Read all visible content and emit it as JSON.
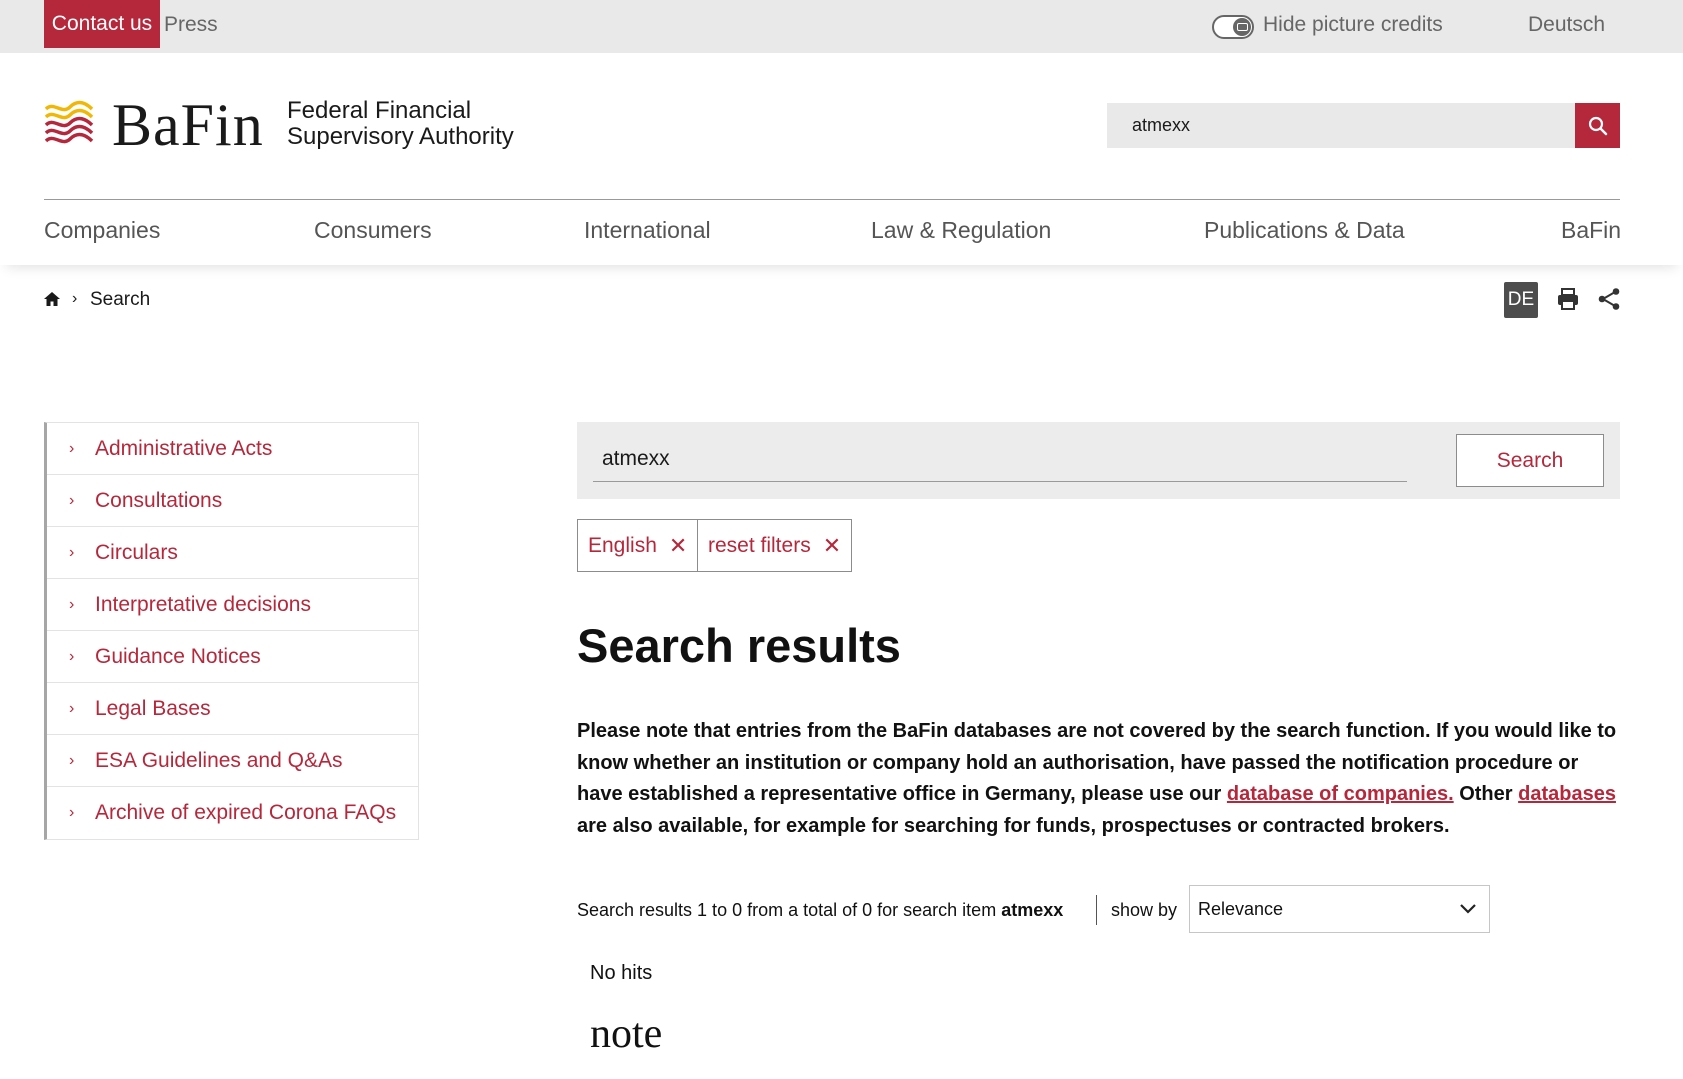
{
  "topbar": {
    "contact_label": "Contact us",
    "press_label": "Press",
    "credits_label": "Hide picture credits",
    "language_label": "Deutsch"
  },
  "header": {
    "logo_word": "BaFin",
    "logo_sub_line1": "Federal Financial",
    "logo_sub_line2": "Supervisory Authority",
    "search_value": "atmexx"
  },
  "nav": {
    "items": [
      "Companies",
      "Consumers",
      "International",
      "Law & Regulation",
      "Publications & Data",
      "BaFin"
    ]
  },
  "breadcrumb": {
    "current": "Search",
    "separator": "›",
    "de_label": "DE"
  },
  "sidebar": {
    "items": [
      "Administrative Acts",
      "Consultations",
      "Circulars",
      "Interpretative decisions",
      "Guidance Notices",
      "Legal Bases",
      "ESA Guidelines and Q&As",
      "Archive of expired Corona FAQs"
    ]
  },
  "search": {
    "value": "atmexx",
    "button_label": "Search",
    "filters": [
      "English",
      "reset filters"
    ],
    "filter_close_glyph": "✕"
  },
  "results": {
    "title": "Search results",
    "note_part1": "Please note that entries from the BaFin databases are not covered by the search function. If you would like to know whether an institution or company hold an authorisation, have passed the notification procedure or have established a representative office in Germany, please use our ",
    "note_link1": "database of companies.",
    "note_part2": " Other ",
    "note_link2": "databases",
    "note_part3": " are also available, for example for searching for funds, prospectuses or contracted brokers.",
    "count_text": "Search results 1 to 0 from a total of 0 for search item ",
    "count_term": "atmexx",
    "show_by_label": "show by",
    "sort_value": "Relevance",
    "no_hits": "No hits",
    "note_heading": "note"
  },
  "colors": {
    "brand_red": "#b5283c",
    "topbar_bg": "#e9e9e9",
    "logo_yellow": "#f2b705"
  }
}
